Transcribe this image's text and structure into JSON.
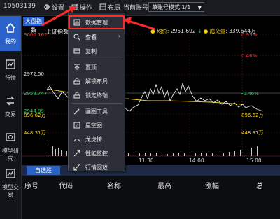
{
  "topbar": {
    "account": "10503139",
    "settings_label": "设置",
    "operate_label": "操作",
    "layout_label": "布局",
    "current_account_label": "当前账号",
    "mode_value": "单账号模式 1/1"
  },
  "sidebar": {
    "items": [
      {
        "label": "我的",
        "icon": "home-icon"
      },
      {
        "label": "行情",
        "icon": "market-icon"
      },
      {
        "label": "交易",
        "icon": "trade-icon"
      },
      {
        "label": "模型研究",
        "icon": "research-icon"
      },
      {
        "label": "模型交易",
        "icon": "model-trade-icon"
      }
    ]
  },
  "chart": {
    "tab": "大盘指数",
    "title": "上证指数",
    "avg_label": "均价:",
    "avg_value": "2951.692",
    "volume_label": "成交量:",
    "volume_value": "339.644万",
    "left_axis": [
      "3000.162",
      "2972.50",
      "2958.747",
      "2944.99",
      "896.62万",
      "448.31万"
    ],
    "right_axis": [
      "0.93%",
      "0.46%",
      "-0.46%",
      "896.62万",
      "448.31万"
    ],
    "times": [
      "11:30",
      "14:00",
      "15:00"
    ]
  },
  "watchlist": {
    "tab": "自选股",
    "headers": [
      "序号",
      "代码",
      "名称",
      "最高",
      "涨幅",
      "总"
    ]
  },
  "menu": {
    "items": [
      {
        "label": "数据管理",
        "icon": "data-manage-icon",
        "arrow": ""
      },
      {
        "label": "查看",
        "icon": "view-icon",
        "arrow": "›"
      },
      {
        "label": "复制",
        "icon": "copy-icon",
        "arrow": ""
      },
      {
        "label": "置顶",
        "icon": "pin-top-icon",
        "arrow": ""
      },
      {
        "label": "解锁布局",
        "icon": "unlock-layout-icon",
        "arrow": ""
      },
      {
        "label": "锁定终端",
        "icon": "lock-terminal-icon",
        "arrow": ""
      },
      {
        "label": "画图工具",
        "icon": "draw-tool-icon",
        "arrow": ""
      },
      {
        "label": "星空图",
        "icon": "star-chart-icon",
        "arrow": ""
      },
      {
        "label": "龙虎榜",
        "icon": "dragon-tiger-icon",
        "arrow": ""
      },
      {
        "label": "性能监控",
        "icon": "performance-icon",
        "arrow": ""
      },
      {
        "label": "行情回放",
        "icon": "replay-icon",
        "arrow": ""
      }
    ]
  },
  "colors": {
    "accent": "#2a62c9",
    "up": "#ff3b3b",
    "down": "#1fd35a",
    "annotation": "#ff2a2a"
  }
}
